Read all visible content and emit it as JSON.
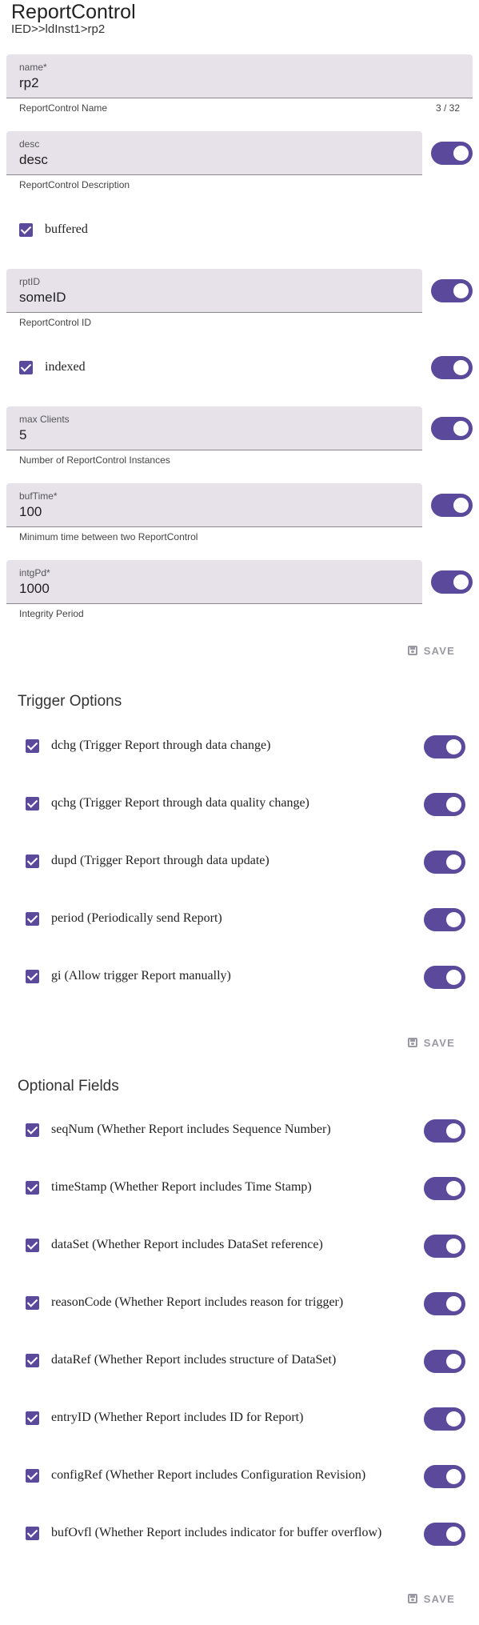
{
  "header": {
    "title": "ReportControl",
    "breadcrumb": "IED>>ldInst1>rp2"
  },
  "fields": {
    "name": {
      "label": "name*",
      "value": "rp2",
      "helper": "ReportControl Name",
      "counter": "3 / 32"
    },
    "desc": {
      "label": "desc",
      "value": "desc",
      "helper": "ReportControl Description",
      "nullable_on": true
    },
    "rptID": {
      "label": "rptID",
      "value": "someID",
      "helper": "ReportControl ID",
      "nullable_on": true
    },
    "maxClients": {
      "label": "max Clients",
      "value": "5",
      "helper": "Number of ReportControl Instances",
      "nullable_on": true
    },
    "bufTime": {
      "label": "bufTime*",
      "value": "100",
      "helper": "Minimum time between two ReportControl",
      "nullable_on": true
    },
    "intgPd": {
      "label": "intgPd*",
      "value": "1000",
      "helper": "Integrity Period",
      "nullable_on": true
    }
  },
  "checks": {
    "buffered": {
      "label": "buffered",
      "checked": true
    },
    "indexed": {
      "label": "indexed",
      "checked": true,
      "nullable_on": true
    }
  },
  "save_label": "SAVE",
  "trigger_options": {
    "title": "Trigger Options",
    "items": [
      {
        "label": "dchg (Trigger Report through data change)",
        "checked": true,
        "toggle_on": true
      },
      {
        "label": "qchg (Trigger Report through data quality change)",
        "checked": true,
        "toggle_on": true
      },
      {
        "label": "dupd (Trigger Report through data update)",
        "checked": true,
        "toggle_on": true
      },
      {
        "label": "period (Periodically send Report)",
        "checked": true,
        "toggle_on": true
      },
      {
        "label": "gi (Allow trigger Report manually)",
        "checked": true,
        "toggle_on": true
      }
    ]
  },
  "optional_fields": {
    "title": "Optional Fields",
    "items": [
      {
        "label": "seqNum (Whether Report includes Sequence Number)",
        "checked": true,
        "toggle_on": true
      },
      {
        "label": "timeStamp (Whether Report includes Time Stamp)",
        "checked": true,
        "toggle_on": true
      },
      {
        "label": "dataSet (Whether Report includes DataSet reference)",
        "checked": true,
        "toggle_on": true
      },
      {
        "label": "reasonCode (Whether Report includes reason for trigger)",
        "checked": true,
        "toggle_on": true
      },
      {
        "label": "dataRef (Whether Report includes structure of DataSet)",
        "checked": true,
        "toggle_on": true
      },
      {
        "label": "entryID (Whether Report includes ID for Report)",
        "checked": true,
        "toggle_on": true
      },
      {
        "label": "configRef (Whether Report includes Configuration Revision)",
        "checked": true,
        "toggle_on": true
      },
      {
        "label": "bufOvfl (Whether Report includes indicator for buffer overflow)",
        "checked": true,
        "toggle_on": true
      }
    ]
  },
  "colors": {
    "accent": "#5b4a9b",
    "field_bg": "#e7e2ea",
    "save_disabled": "#9a98a2"
  },
  "icons": {
    "save": "save-icon",
    "checkbox": "check-icon"
  }
}
